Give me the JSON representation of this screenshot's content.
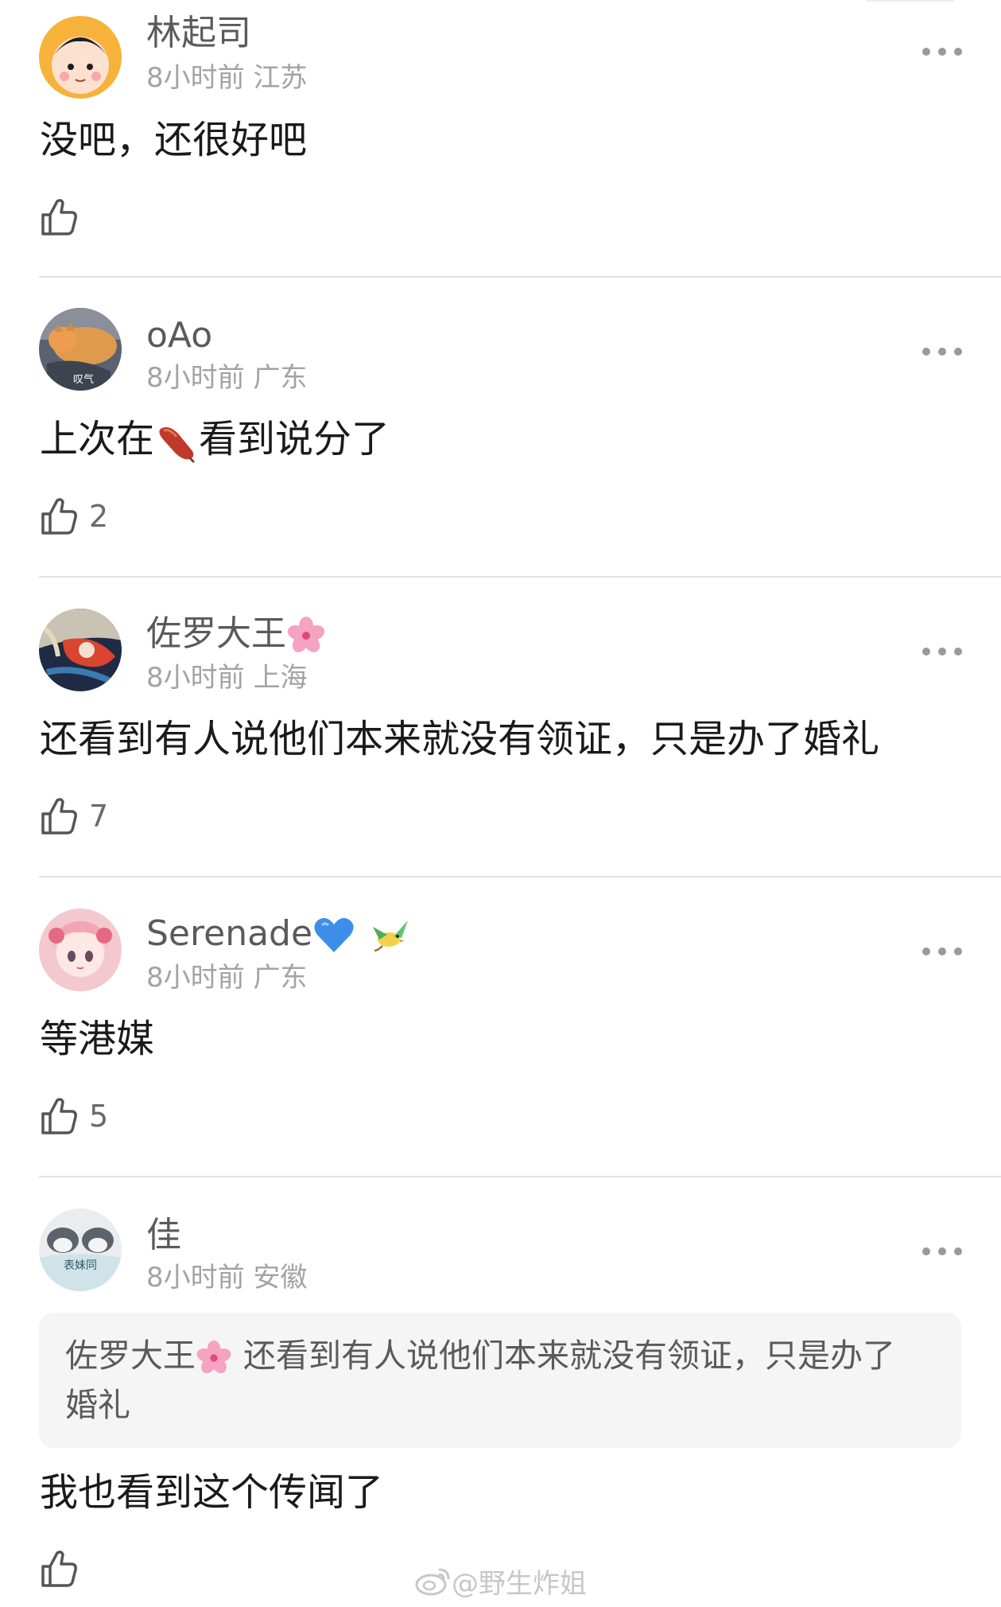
{
  "comments": [
    {
      "username": "林起司",
      "time": "8小时前",
      "location": "江苏",
      "text": "没吧，还很好吧",
      "likes": ""
    },
    {
      "username": "oAo",
      "avatar_text": "叹气",
      "time": "8小时前",
      "location": "广东",
      "text_before": "上次在",
      "text_after": "看到说分了",
      "likes": "2"
    },
    {
      "username": "佐罗大王",
      "time": "8小时前",
      "location": "上海",
      "text": "还看到有人说他们本来就没有领证，只是办了婚礼",
      "likes": "7"
    },
    {
      "username": "Serenade",
      "time": "8小时前",
      "location": "广东",
      "text": "等港媒",
      "likes": "5"
    },
    {
      "username": "佳",
      "avatar_text": "表妹同",
      "time": "8小时前",
      "location": "安徽",
      "quote_author": "佐罗大王",
      "quote_text_line1": "还看到有人说他们本来就没有领证，只是办了",
      "quote_text_line2": "婚礼",
      "text": "我也看到这个传闻了",
      "likes": ""
    }
  ],
  "watermark": "@野生炸姐",
  "icons": {
    "like": "thumbs-up-icon",
    "more": "more-dots-icon",
    "flower": "cherry-blossom-emoji",
    "heart": "blue-heart-emoji",
    "bird": "bird-emoji",
    "sweet_potato": "sweet-potato-emoji",
    "weibo": "weibo-logo-icon"
  },
  "colors": {
    "username": "#5a5a5a",
    "meta": "#a3a3a3",
    "text": "#1a1a1a",
    "divider": "#e2e2e2",
    "quote_bg": "#f5f5f5"
  }
}
